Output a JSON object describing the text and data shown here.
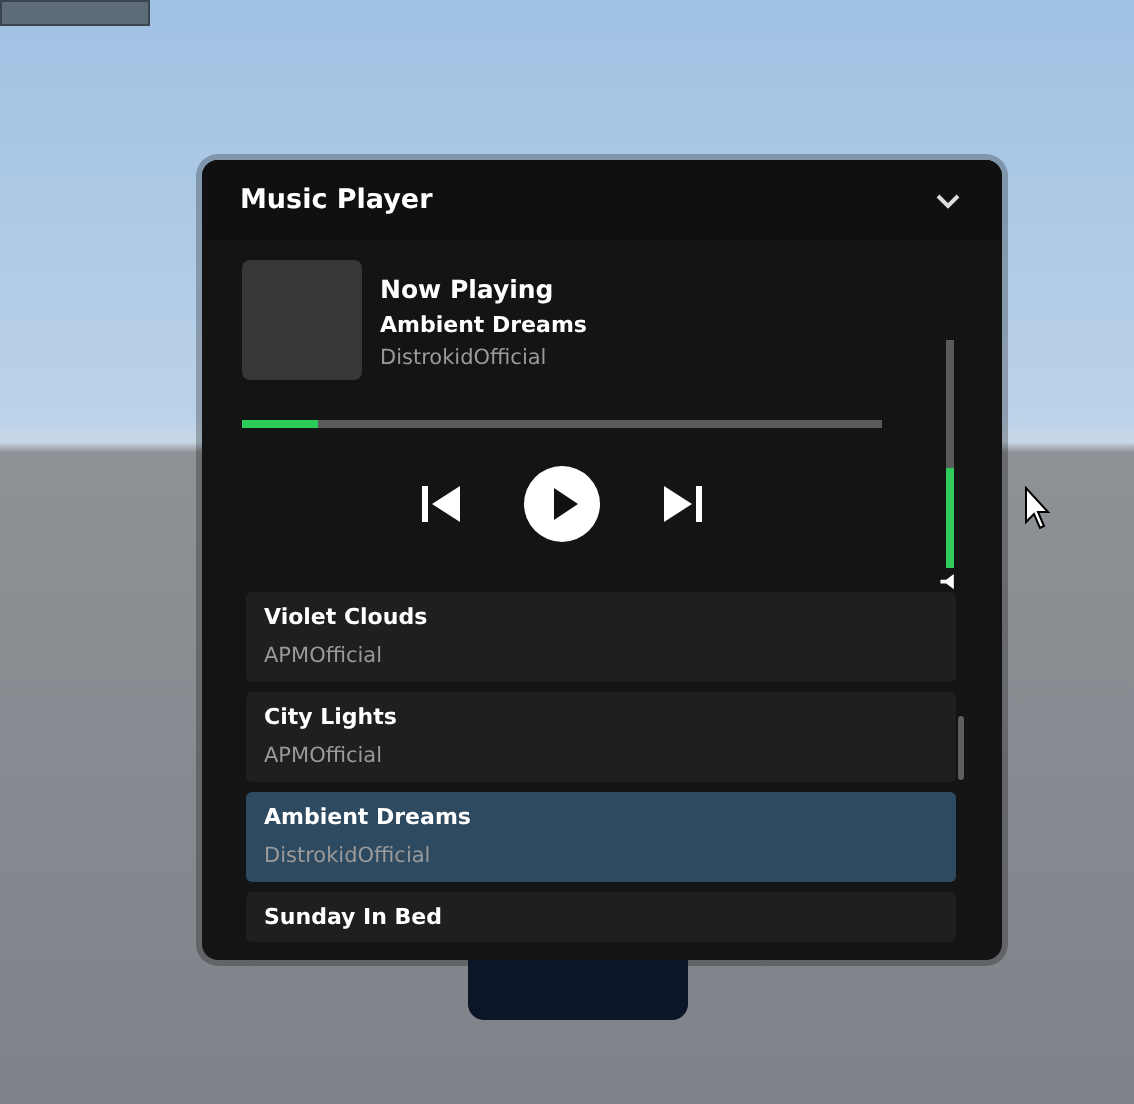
{
  "window": {
    "title": "Music Player",
    "expanded": true
  },
  "now_playing": {
    "heading": "Now Playing",
    "title": "Ambient Dreams",
    "artist": "DistrokidOfficial",
    "progress": {
      "level": 0.12
    },
    "playing": false
  },
  "volume": {
    "level": 0.44
  },
  "playlist": [
    {
      "title": "Violet Clouds",
      "artist": "APMOfficial",
      "selected": false
    },
    {
      "title": "City Lights",
      "artist": "APMOfficial",
      "selected": false
    },
    {
      "title": "Ambient Dreams",
      "artist": "DistrokidOfficial",
      "selected": true
    },
    {
      "title": "Sunday In Bed",
      "selected": false
    }
  ]
}
